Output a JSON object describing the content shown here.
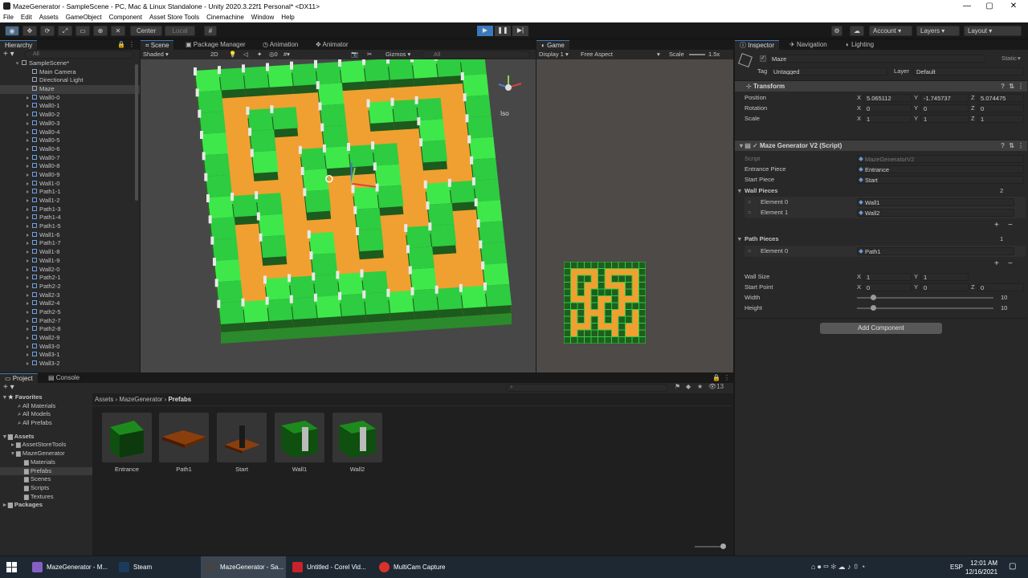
{
  "window": {
    "title": "MazeGenerator - SampleScene - PC, Mac & Linux Standalone - Unity 2020.3.22f1 Personal* <DX11>",
    "minimize": "—",
    "maximize": "▢",
    "close": "✕"
  },
  "menu": [
    "File",
    "Edit",
    "Assets",
    "GameObject",
    "Component",
    "Asset Store Tools",
    "Cinemachine",
    "Window",
    "Help"
  ],
  "toolbar": {
    "pivot": "Center",
    "space": "Local",
    "account": "Account",
    "layers": "Layers",
    "layout": "Layout"
  },
  "hierarchy": {
    "tab": "Hierarchy",
    "search_placeholder": "All",
    "scene": "SampleScene*",
    "items": [
      "Main Camera",
      "Directional Light",
      "Maze",
      "Wall0-0",
      "Wall0-1",
      "Wall0-2",
      "Wall0-3",
      "Wall0-4",
      "Wall0-5",
      "Wall0-6",
      "Wall0-7",
      "Wall0-8",
      "Wall0-9",
      "Wall1-0",
      "Path1-1",
      "Wall1-2",
      "Path1-3",
      "Path1-4",
      "Path1-5",
      "Wall1-6",
      "Path1-7",
      "Wall1-8",
      "Wall1-9",
      "Wall2-0",
      "Path2-1",
      "Path2-2",
      "Wall2-3",
      "Wall2-4",
      "Path2-5",
      "Path2-7",
      "Path2-8",
      "Wall2-9",
      "Wall3-0",
      "Wall3-1",
      "Wall3-2"
    ],
    "selected": "Maze"
  },
  "scene_view": {
    "tabs": [
      "Scene",
      "Package Manager",
      "Animation",
      "Animator"
    ],
    "shading": "Shaded",
    "mode2d": "2D",
    "gizmos": "Gizmos",
    "search": "All",
    "layers_count": "0",
    "persp": "Iso"
  },
  "game_view": {
    "tab": "Game",
    "display": "Display 1",
    "aspect": "Free Aspect",
    "scale_label": "Scale",
    "scale_value": "1.5x"
  },
  "inspector": {
    "tabs": [
      "Inspector",
      "Navigation",
      "Lighting"
    ],
    "object_name": "Maze",
    "static_label": "Static",
    "tag_label": "Tag",
    "tag": "Untagged",
    "layer_label": "Layer",
    "layer": "Default",
    "transform": {
      "title": "Transform",
      "position_label": "Position",
      "position": {
        "x": "5.065112",
        "y": "-1.745737",
        "z": "5.074475"
      },
      "rotation_label": "Rotation",
      "rotation": {
        "x": "0",
        "y": "0",
        "z": "0"
      },
      "scale_label": "Scale",
      "scale": {
        "x": "1",
        "y": "1",
        "z": "1"
      }
    },
    "script_component": {
      "title": "Maze Generator V2 (Script)",
      "script_label": "Script",
      "script": "MazeGeneratorV2",
      "entrance_label": "Entrance Piece",
      "entrance": "Entrance",
      "start_label": "Start Piece",
      "start": "Start",
      "wall_pieces_label": "Wall Pieces",
      "wall_pieces_count": "2",
      "wall_pieces": [
        {
          "label": "Element 0",
          "value": "Wall1"
        },
        {
          "label": "Element 1",
          "value": "Wall2"
        }
      ],
      "path_pieces_label": "Path Pieces",
      "path_pieces_count": "1",
      "path_pieces": [
        {
          "label": "Element 0",
          "value": "Path1"
        }
      ],
      "wall_size_label": "Wall Size",
      "wall_size": {
        "x": "1",
        "y": "1"
      },
      "start_point_label": "Start Point",
      "start_point": {
        "x": "0",
        "y": "0",
        "z": "0"
      },
      "width_label": "Width",
      "width": "10",
      "height_label": "Height",
      "height": "10"
    },
    "add_component": "Add Component"
  },
  "project": {
    "tabs": [
      "Project",
      "Console"
    ],
    "breadcrumb": [
      "Assets",
      "MazeGenerator",
      "Prefabs"
    ],
    "favorites_label": "Favorites",
    "favorites": [
      "All Materials",
      "All Models",
      "All Prefabs"
    ],
    "assets_label": "Assets",
    "tree": [
      "AssetStoreTools",
      "MazeGenerator",
      "Materials",
      "Prefabs",
      "Scenes",
      "Scripts",
      "Textures"
    ],
    "packages_label": "Packages",
    "hidden_count": "13",
    "assets": [
      "Entrance",
      "Path1",
      "Start",
      "Wall1",
      "Wall2"
    ]
  },
  "taskbar": {
    "items": [
      "MazeGenerator - M...",
      "Steam",
      "MazeGenerator - Sa...",
      "Untitled - Corel Vid...",
      "MultiCam Capture"
    ],
    "lang": "ESP",
    "time": "12:01 AM",
    "date": "12/16/2021"
  },
  "colors": {
    "accent": "#3a79bb",
    "wall": "#2ecc40",
    "path": "#f0a030"
  }
}
